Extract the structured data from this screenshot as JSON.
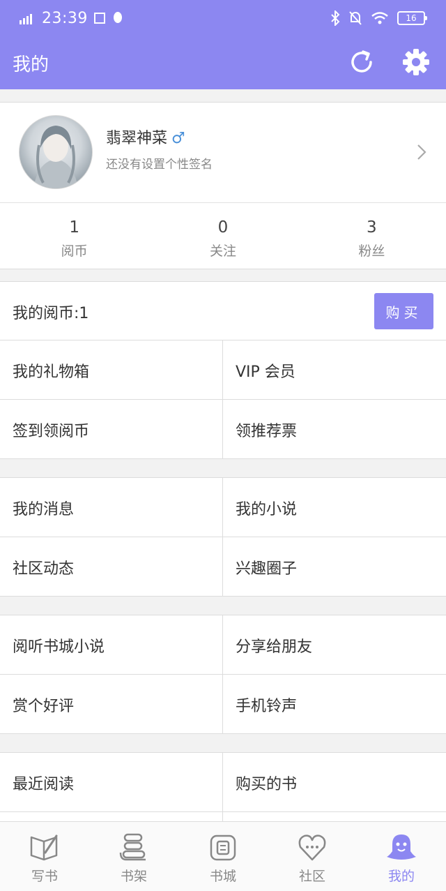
{
  "status_bar": {
    "network": "4G",
    "time": "23:39",
    "battery": "16"
  },
  "header": {
    "title": "我的",
    "refresh_icon": "refresh-icon",
    "settings_icon": "gear-icon"
  },
  "profile": {
    "username": "翡翠神菜",
    "gender_symbol": "♂",
    "signature": "还没有设置个性签名",
    "stats": [
      {
        "value": "1",
        "label": "阅币"
      },
      {
        "value": "0",
        "label": "关注"
      },
      {
        "value": "3",
        "label": "粉丝"
      }
    ]
  },
  "coins": {
    "label": "我的阅币:1",
    "buy_label": "购买"
  },
  "menu": {
    "group1": [
      [
        "我的礼物箱",
        "VIP 会员"
      ],
      [
        "签到领阅币",
        "领推荐票"
      ]
    ],
    "group2": [
      [
        "我的消息",
        "我的小说"
      ],
      [
        "社区动态",
        "兴趣圈子"
      ]
    ],
    "group3": [
      [
        "阅听书城小说",
        "分享给朋友"
      ],
      [
        "赏个好评",
        "手机铃声"
      ]
    ],
    "group4": [
      [
        "最近阅读",
        "购买的书"
      ]
    ]
  },
  "tabs": [
    {
      "label": "写书",
      "icon": "write-book-icon",
      "active": false
    },
    {
      "label": "书架",
      "icon": "bookshelf-icon",
      "active": false
    },
    {
      "label": "书城",
      "icon": "bookstore-icon",
      "active": false
    },
    {
      "label": "社区",
      "icon": "community-icon",
      "active": false
    },
    {
      "label": "我的",
      "icon": "profile-icon",
      "active": true
    }
  ],
  "colors": {
    "accent": "#8c87f1",
    "gender": "#4a90d9"
  }
}
